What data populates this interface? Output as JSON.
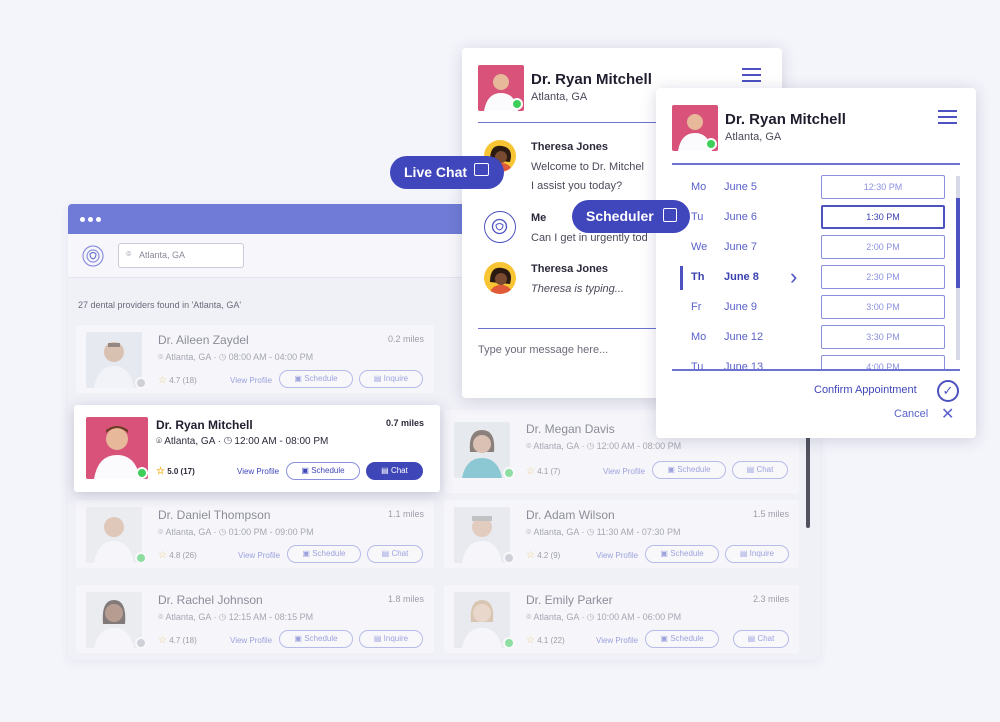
{
  "search": {
    "placeholder": "Atlanta, GA"
  },
  "results": {
    "count_text": "27 dental providers found in 'Atlanta, GA'"
  },
  "doctors": [
    {
      "name": "Dr. Aileen Zaydel",
      "miles": "0.2 miles",
      "location": "Atlanta, GA",
      "hours": "08:00 AM - 04:00 PM",
      "rating": "4.7 (18)",
      "view": "View Profile",
      "schedule": "Schedule",
      "action": "Inquire"
    },
    {
      "name": "Dr. Ryan Mitchell",
      "miles": "0.7 miles",
      "location": "Atlanta, GA",
      "hours": "12:00 AM - 08:00 PM",
      "rating": "5.0 (17)",
      "view": "View Profile",
      "schedule": "Schedule",
      "action": "Chat"
    },
    {
      "name": "Dr. Megan Davis",
      "miles": "",
      "location": "Atlanta, GA",
      "hours": "12:00 AM - 08:00 PM",
      "rating": "4.1 (7)",
      "view": "View Profile",
      "schedule": "Schedule",
      "action": "Chat"
    },
    {
      "name": "Dr. Daniel Thompson",
      "miles": "1.1 miles",
      "location": "Atlanta, GA",
      "hours": "01:00 PM - 09:00 PM",
      "rating": "4.8 (26)",
      "view": "View Profile",
      "schedule": "Schedule",
      "action": "Chat"
    },
    {
      "name": "Dr. Adam Wilson",
      "miles": "1.5 miles",
      "location": "Atlanta, GA",
      "hours": "11:30 AM - 07:30 PM",
      "rating": "4.2 (9)",
      "view": "View Profile",
      "schedule": "Schedule",
      "action": "Inquire"
    },
    {
      "name": "Dr. Rachel Johnson",
      "miles": "1.8 miles",
      "location": "Atlanta, GA",
      "hours": "12:15 AM - 08:15 PM",
      "rating": "4.7 (18)",
      "view": "View Profile",
      "schedule": "Schedule",
      "action": "Inquire"
    },
    {
      "name": "Dr. Emily Parker",
      "miles": "2.3 miles",
      "location": "Atlanta, GA",
      "hours": "10:00 AM - 06:00 PM",
      "rating": "4.1 (22)",
      "view": "View Profile",
      "schedule": "Schedule",
      "action": "Chat"
    }
  ],
  "chat": {
    "doctor_name": "Dr. Ryan Mitchell",
    "doctor_location": "Atlanta, GA",
    "messages": [
      {
        "sender": "Theresa Jones",
        "line1": "Welcome to Dr. Mitchel",
        "line2": "I assist you today?"
      },
      {
        "sender": "Me",
        "line1": "Can I get in urgently tod"
      },
      {
        "sender": "Theresa Jones",
        "line1": "Theresa is typing..."
      }
    ],
    "input_placeholder": "Type your message here..."
  },
  "scheduler": {
    "doctor_name": "Dr. Ryan Mitchell",
    "doctor_location": "Atlanta, GA",
    "days": [
      {
        "dow": "Mo",
        "date": "June 5",
        "slot": "12:30 PM"
      },
      {
        "dow": "Tu",
        "date": "June 6",
        "slot": "1:30 PM"
      },
      {
        "dow": "We",
        "date": "June 7",
        "slot": "2:00 PM"
      },
      {
        "dow": "Th",
        "date": "June 8",
        "slot": "2:30 PM"
      },
      {
        "dow": "Fr",
        "date": "June 9",
        "slot": "3:00 PM"
      },
      {
        "dow": "Mo",
        "date": "June 12",
        "slot": "3:30 PM"
      },
      {
        "dow": "Tu",
        "date": "June 13",
        "slot": "4:00 PM"
      }
    ],
    "confirm_label": "Confirm Appointment",
    "cancel_label": "Cancel"
  },
  "pills": {
    "live_chat": "Live Chat",
    "scheduler": "Scheduler"
  },
  "colors": {
    "accent": "#3f46b8",
    "app_bar": "#6f7bd6",
    "online": "#3ecf5a"
  }
}
